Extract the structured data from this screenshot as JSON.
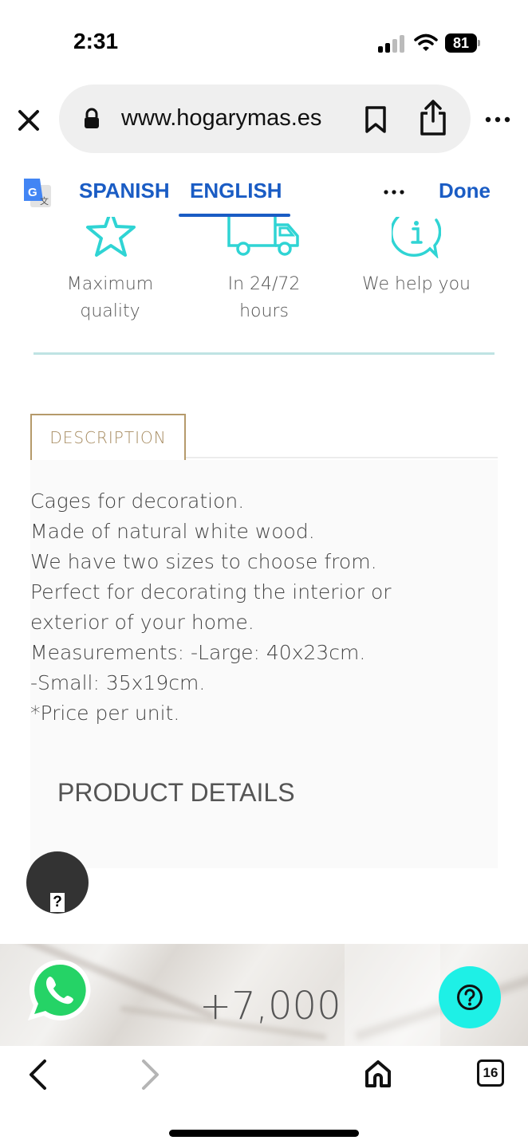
{
  "status_bar": {
    "time": "2:31",
    "battery": "81"
  },
  "browser": {
    "url": "www.hogarymas.es"
  },
  "translate_bar": {
    "source_language": "SPANISH",
    "target_language": "ENGLISH",
    "done_label": "Done",
    "accent_color": "#1a5cc4"
  },
  "features": [
    {
      "icon": "star-icon",
      "line1": "Maximum",
      "line2": "quality"
    },
    {
      "icon": "delivery-truck-icon",
      "line1": "In 24/72",
      "line2": "hours"
    },
    {
      "icon": "info-bubble-icon",
      "line1": "We help you",
      "line2": ""
    }
  ],
  "description": {
    "tab_label": "DESCRIPTION",
    "lines": [
      "Cages for decoration.",
      "Made of natural white wood.",
      "We have two sizes to choose from.",
      "Perfect for decorating the interior or",
      "exterior of your home.",
      "Measurements: -Large: 40x23cm.",
      "-Small: 35x19cm.",
      "*Price per unit."
    ],
    "product_details_label": "PRODUCT DETAILS"
  },
  "help_bubble": {
    "glyph": "?"
  },
  "banner": {
    "count": "+7,000"
  },
  "toolbar": {
    "tab_count": "16"
  },
  "colors": {
    "feature_icon": "#2fd4d4",
    "tab_border": "#b59a6b",
    "help_fab": "#1ef0e6",
    "whatsapp": "#25d366"
  }
}
